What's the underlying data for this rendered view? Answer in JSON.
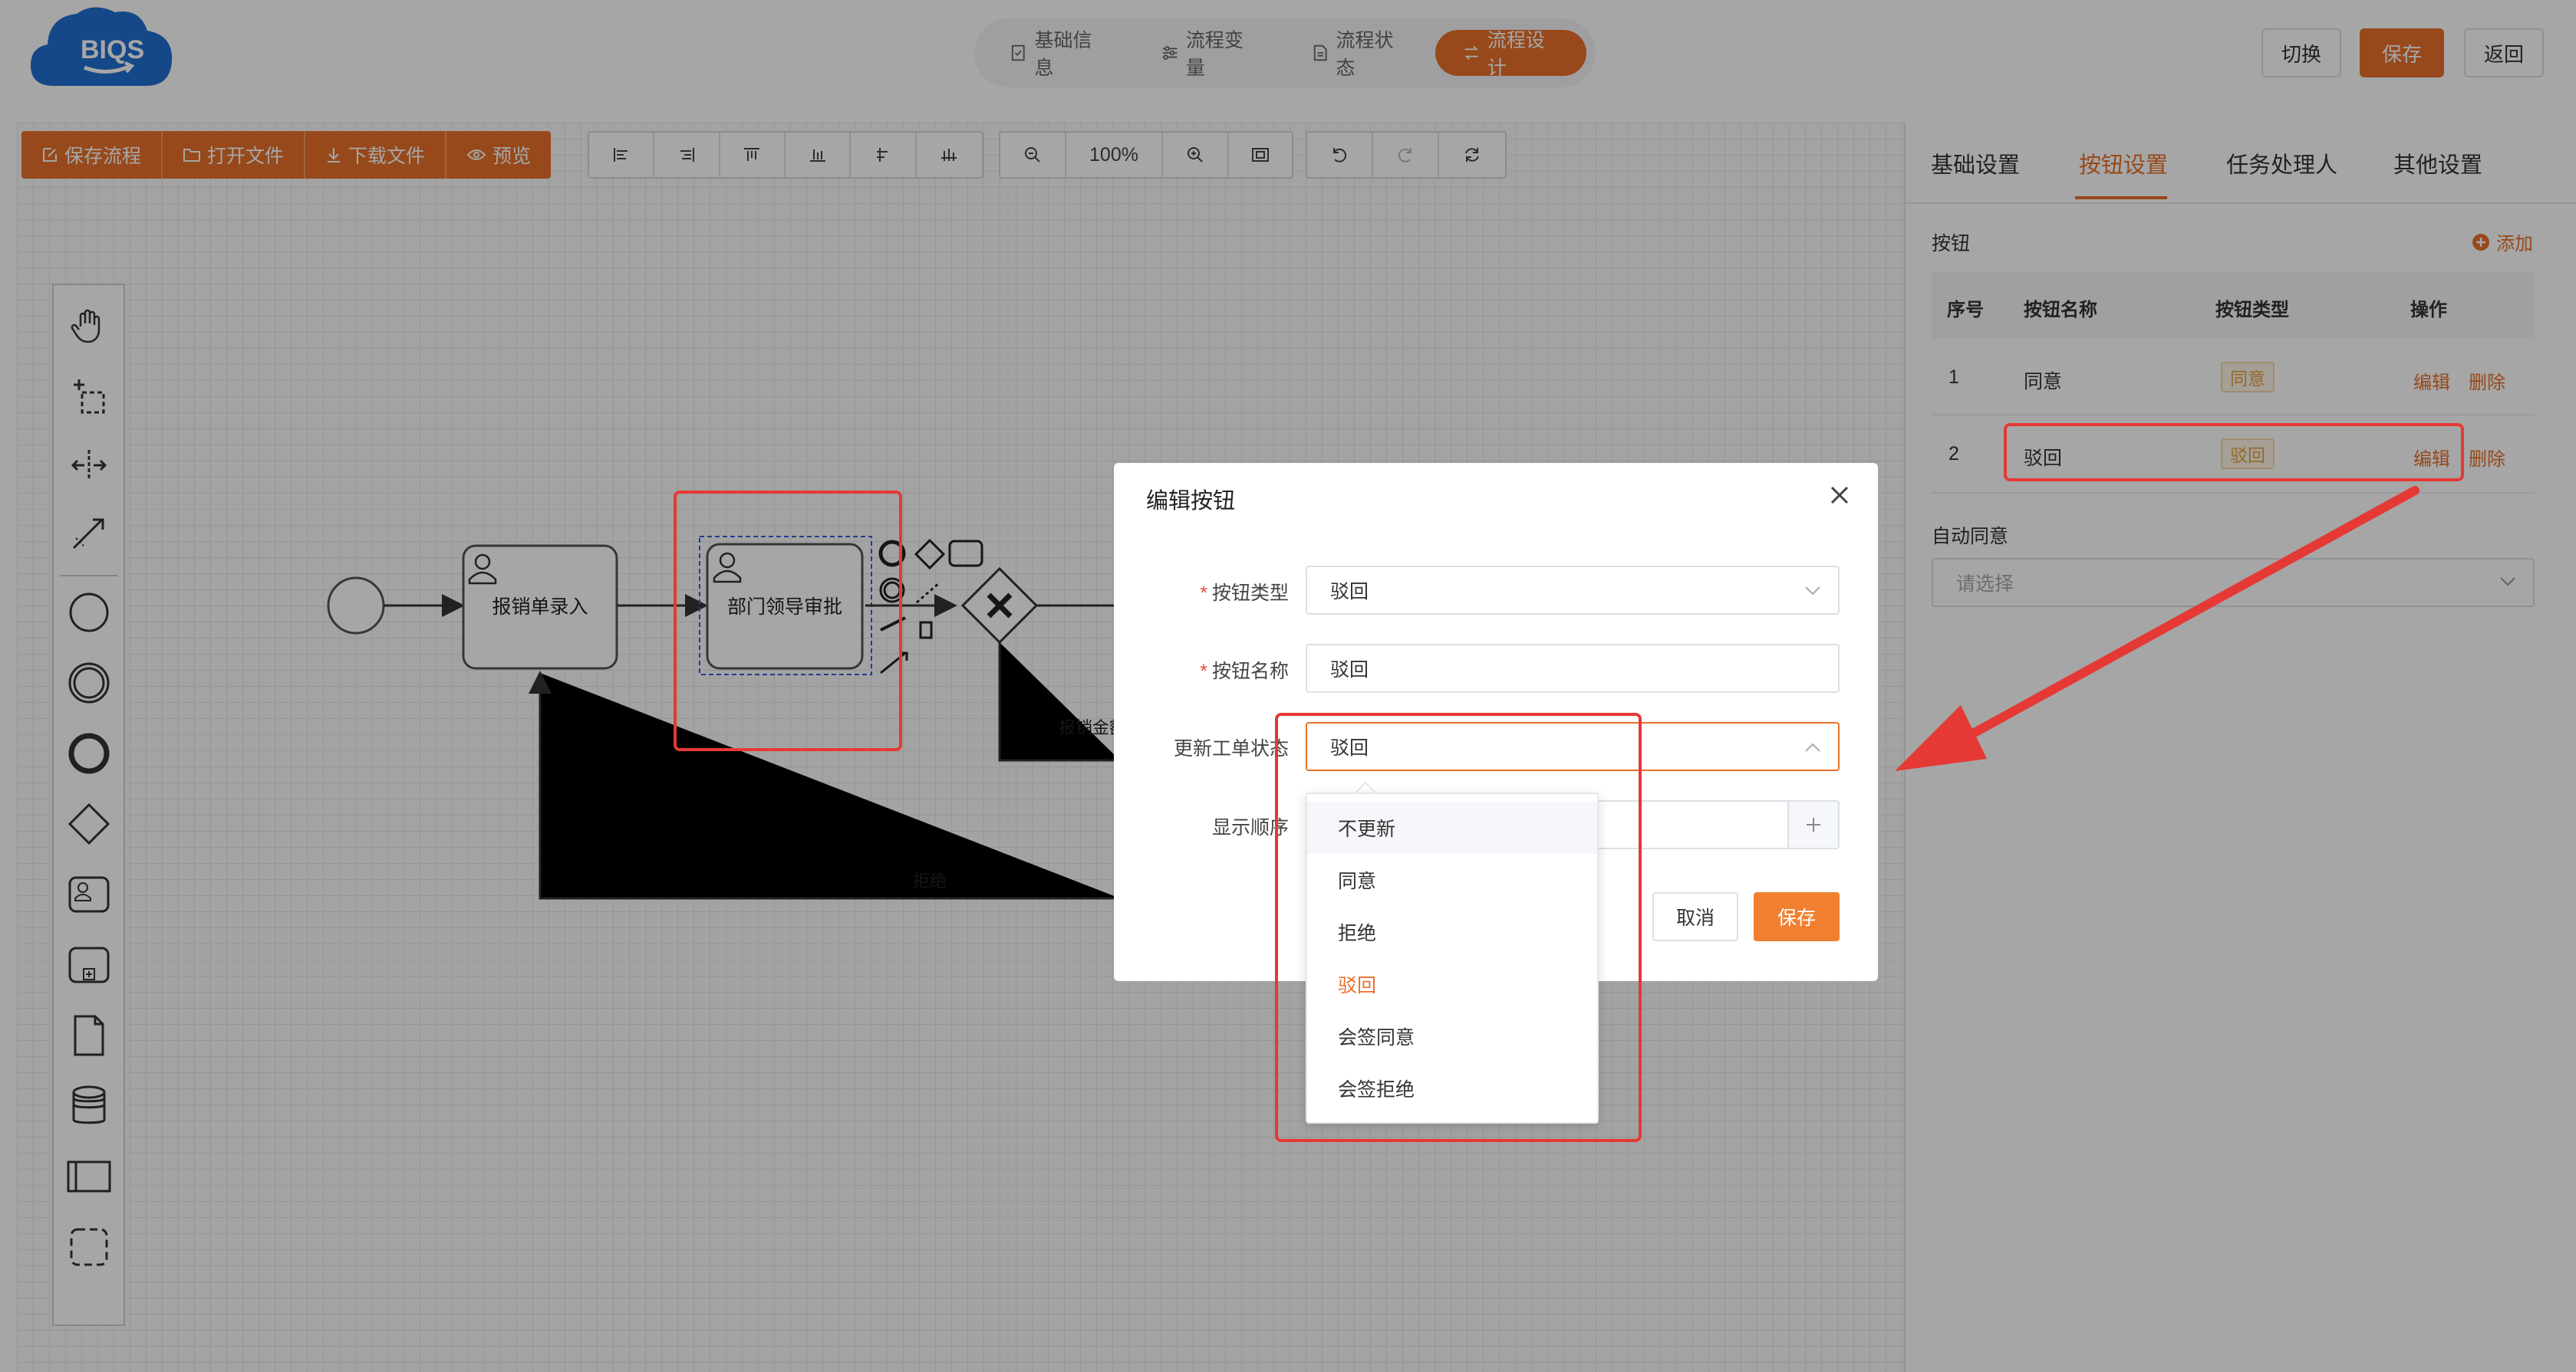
{
  "header": {
    "logo_text": "BIQS",
    "steps": [
      {
        "label": "基础信息",
        "icon": "doc-check-icon"
      },
      {
        "label": "流程变量",
        "icon": "sliders-icon"
      },
      {
        "label": "流程状态",
        "icon": "doc-icon"
      },
      {
        "label": "流程设计",
        "icon": "flow-icon",
        "active": true
      }
    ],
    "switch_label": "切换",
    "save_label": "保存",
    "back_label": "返回"
  },
  "toolbar": {
    "save_flow": "保存流程",
    "open_file": "打开文件",
    "download_file": "下载文件",
    "preview": "预览",
    "zoom": "100%"
  },
  "diagram": {
    "task1": "报销单录入",
    "task2": "部门领导审批",
    "flow_reject": "拒绝",
    "flow_amount": "报销金额"
  },
  "right_panel": {
    "tabs": [
      "基础设置",
      "按钮设置",
      "任务处理人",
      "其他设置"
    ],
    "active_tab": 1,
    "section_label": "按钮",
    "add_label": "添加",
    "columns": [
      "序号",
      "按钮名称",
      "按钮类型",
      "操作"
    ],
    "rows": [
      {
        "index": "1",
        "name": "同意",
        "type": "同意",
        "edit": "编辑",
        "delete": "删除"
      },
      {
        "index": "2",
        "name": "驳回",
        "type": "驳回",
        "edit": "编辑",
        "delete": "删除"
      }
    ],
    "auto_agree_label": "自动同意",
    "auto_agree_placeholder": "请选择"
  },
  "modal": {
    "title": "编辑按钮",
    "fields": {
      "type_label": "按钮类型",
      "type_value": "驳回",
      "name_label": "按钮名称",
      "name_value": "驳回",
      "status_label": "更新工单状态",
      "status_value": "驳回",
      "order_label": "显示顺序"
    },
    "cancel_label": "取消",
    "save_label": "保存",
    "dropdown_options": [
      "不更新",
      "同意",
      "拒绝",
      "驳回",
      "会签同意",
      "会签拒绝"
    ],
    "dropdown_selected": 3
  },
  "colors": {
    "accent": "#e8702a",
    "annotation_red": "#e53935",
    "tag_text": "#e6a23c"
  }
}
